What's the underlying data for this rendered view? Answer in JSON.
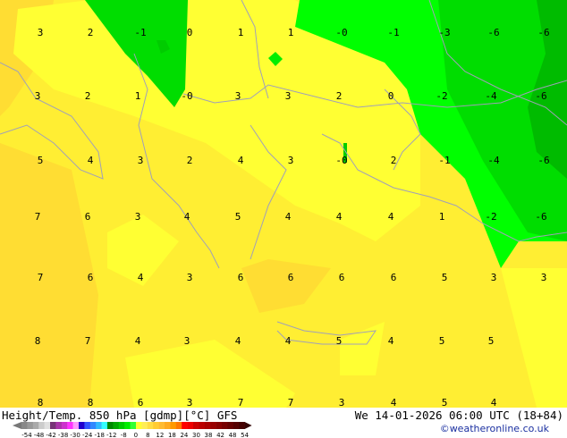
{
  "map": {
    "field": "Height/Temp. 850 hPa [gdmp][°C]",
    "model": "GFS",
    "valid_time": "We 14-01-2026 06:00 UTC (18+84)",
    "credit": "©weatheronline.co.uk",
    "label_rows": [
      [
        "3",
        "2",
        "-1",
        "0",
        "1",
        "1",
        "-0",
        "-1",
        "-3",
        "-6",
        "-6"
      ],
      [
        "3",
        "2",
        "1",
        "-0",
        "3",
        "3",
        "2",
        "0",
        "-2",
        "-4",
        "-6"
      ],
      [
        "5",
        "4",
        "3",
        "2",
        "4",
        "3",
        "-0",
        "2",
        "-1",
        "-4",
        "-6"
      ],
      [
        "7",
        "6",
        "3",
        "4",
        "5",
        "4",
        "4",
        "4",
        "1",
        "-2",
        "-6"
      ],
      [
        "7",
        "6",
        "4",
        "3",
        "6",
        "6",
        "6",
        "6",
        "5",
        "3",
        "3"
      ],
      [
        "8",
        "7",
        "4",
        "3",
        "4",
        "4",
        "5",
        "4",
        "5",
        "5"
      ],
      [
        "8",
        "8",
        "6",
        "3",
        "7",
        "7",
        "3",
        "4",
        "5",
        "4"
      ]
    ],
    "colors": {
      "yellow_light": "#ffff33",
      "yellow": "#ffee33",
      "yellow_dark": "#ffdd33",
      "green_light": "#00ff00",
      "green": "#00dd00",
      "green_dark": "#00bb00",
      "coast": "#a0a0b8"
    }
  },
  "legend": {
    "ticks": [
      "-54",
      "-48",
      "-42",
      "-38",
      "-30",
      "-24",
      "-18",
      "-12",
      "-8",
      "0",
      "8",
      "12",
      "18",
      "24",
      "30",
      "38",
      "42",
      "48",
      "54"
    ],
    "colors": [
      "#888888",
      "#999999",
      "#aaaaaa",
      "#cccccc",
      "#e0e0e0",
      "#773377",
      "#aa33aa",
      "#cc33cc",
      "#ff33ff",
      "#ff99ff",
      "#2200cc",
      "#3355ff",
      "#3388ff",
      "#33bbff",
      "#33ffff",
      "#008800",
      "#00aa00",
      "#00cc00",
      "#00ee00",
      "#33ff33",
      "#ffff33",
      "#ffee55",
      "#ffdd44",
      "#ffcc33",
      "#ffbb33",
      "#ffaa22",
      "#ff9900",
      "#ff7700",
      "#ff0000",
      "#ee0000",
      "#cc0000",
      "#bb0000",
      "#aa0000",
      "#990000",
      "#880000",
      "#770000",
      "#660000",
      "#550000",
      "#440000"
    ]
  }
}
